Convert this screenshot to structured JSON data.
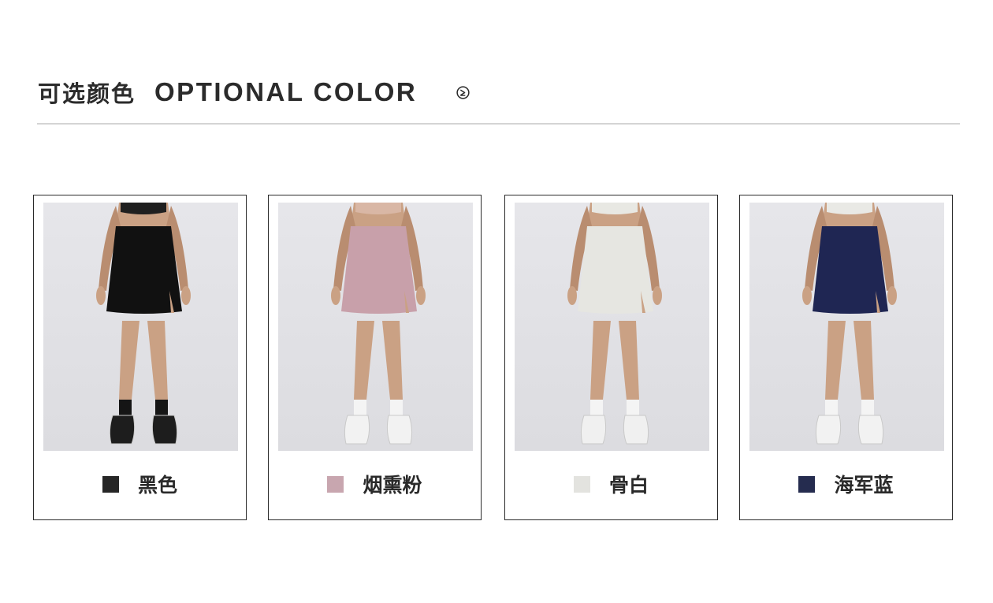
{
  "header": {
    "title_cn": "可选颜色",
    "title_en": "OPTIONAL COLOR",
    "arrow_icon": "chevron-right-circle-icon"
  },
  "colors": [
    {
      "name": "黑色",
      "swatch": "#262626",
      "skirt": "#111111",
      "shoe": "#1d1d1d",
      "sock": "#151515",
      "top": "#1f1f1f"
    },
    {
      "name": "烟熏粉",
      "swatch": "#c8a6af",
      "skirt": "#c8a0aa",
      "shoe": "#f2f2f2",
      "sock": "#f4f4f4",
      "top": "#d9b7a5"
    },
    {
      "name": "骨白",
      "swatch": "#e3e3df",
      "skirt": "#e6e6e1",
      "shoe": "#f0f0f0",
      "sock": "#f4f4f4",
      "top": "#e8e8e3"
    },
    {
      "name": "海军蓝",
      "swatch": "#252c4f",
      "skirt": "#1f2653",
      "shoe": "#f2f2f2",
      "sock": "#f4f4f4",
      "top": "#e9e9e5"
    }
  ]
}
